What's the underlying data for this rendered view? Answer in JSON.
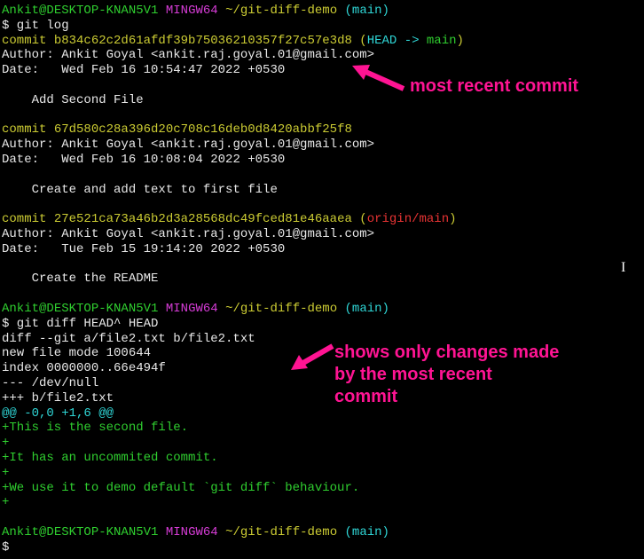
{
  "prompt1": {
    "user": "Ankit",
    "host": "DESKTOP-KNAN5V1",
    "env": "MINGW64",
    "path": "~/git-diff-demo",
    "branch": "(main)"
  },
  "cmd1": "$ git log",
  "commit1": {
    "prefix": "commit ",
    "hash": "b834c62c2d61afdf39b75036210357f27c57e3d8",
    "ref_open": " (",
    "head": "HEAD -> ",
    "branch": "main",
    "ref_close": ")",
    "author": "Author: Ankit Goyal <ankit.raj.goyal.01@gmail.com>",
    "date": "Date:   Wed Feb 16 10:54:47 2022 +0530",
    "msg": "    Add Second File"
  },
  "commit2": {
    "prefix": "commit ",
    "hash": "67d580c28a396d20c708c16deb0d8420abbf25f8",
    "author": "Author: Ankit Goyal <ankit.raj.goyal.01@gmail.com>",
    "date": "Date:   Wed Feb 16 10:08:04 2022 +0530",
    "msg": "    Create and add text to first file"
  },
  "commit3": {
    "prefix": "commit ",
    "hash": "27e521ca73a46b2d3a28568dc49fced81e46aaea",
    "ref_open": " (",
    "remote": "origin/main",
    "ref_close": ")",
    "author": "Author: Ankit Goyal <ankit.raj.goyal.01@gmail.com>",
    "date": "Date:   Tue Feb 15 19:14:20 2022 +0530",
    "msg": "    Create the README"
  },
  "prompt2": {
    "user": "Ankit",
    "host": "DESKTOP-KNAN5V1",
    "env": "MINGW64",
    "path": "~/git-diff-demo",
    "branch": "(main)"
  },
  "cmd2": "$ git diff HEAD^ HEAD",
  "diff": {
    "header1": "diff --git a/file2.txt b/file2.txt",
    "header2": "new file mode 100644",
    "header3": "index 0000000..66e494f",
    "header4": "--- /dev/null",
    "header5": "+++ b/file2.txt",
    "hunk": "@@ -0,0 +1,6 @@",
    "add1": "+This is the second file.",
    "add2": "+",
    "add3": "+It has an uncommited commit.",
    "add4": "+",
    "add5": "+We use it to demo default `git diff` behaviour.",
    "add6": "+"
  },
  "prompt3": {
    "user": "Ankit",
    "host": "DESKTOP-KNAN5V1",
    "env": "MINGW64",
    "path": "~/git-diff-demo",
    "branch": "(main)"
  },
  "cmd3": "$",
  "annotation1": "most recent commit",
  "annotation2_l1": "shows only changes made",
  "annotation2_l2": "by the most recent",
  "annotation2_l3": "commit"
}
